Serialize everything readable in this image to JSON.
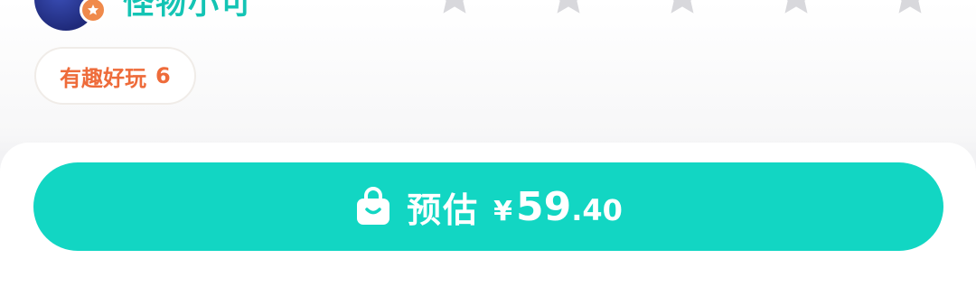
{
  "user": {
    "nickname": "怪物小可"
  },
  "rating": {
    "stars": 5,
    "filled": 0
  },
  "tags": [
    {
      "label": "有趣好玩",
      "count": "6"
    }
  ],
  "purchase": {
    "label": "预估",
    "currency": "¥",
    "price_int": "59",
    "price_dec": ".40"
  },
  "colors": {
    "accent": "#12D6C3",
    "nickname": "#13C4B4",
    "tag_text": "#EE6B3A",
    "star": "#D8D8DC"
  }
}
